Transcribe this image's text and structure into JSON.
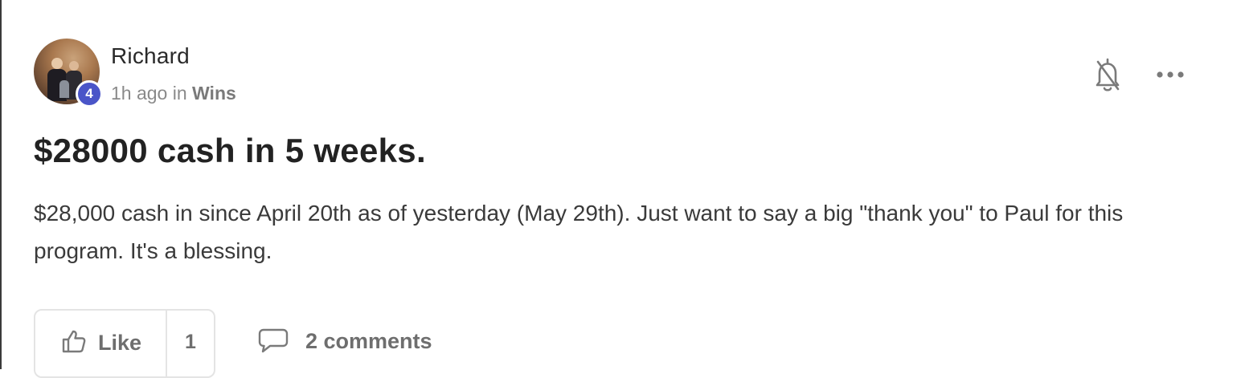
{
  "post": {
    "author": {
      "name": "Richard",
      "level": "4"
    },
    "meta": {
      "time": "1h ago",
      "in_word": "in",
      "category": "Wins"
    },
    "title": "$28000 cash in 5 weeks.",
    "body": "$28,000 cash in since April 20th as of yesterday (May 29th). Just want to say a big \"thank you\" to Paul for this program. It's a blessing.",
    "actions": {
      "like_label": "Like",
      "like_count": "1",
      "comments_label": "2 comments"
    },
    "icons": {
      "notify": "bell-off-icon",
      "more": "more-horizontal-icon",
      "like": "thumbs-up-icon",
      "comment": "comment-bubble-icon"
    },
    "colors": {
      "level_badge": "#4a55c8",
      "text_primary": "#222222",
      "text_muted": "#8a8a8a"
    }
  }
}
